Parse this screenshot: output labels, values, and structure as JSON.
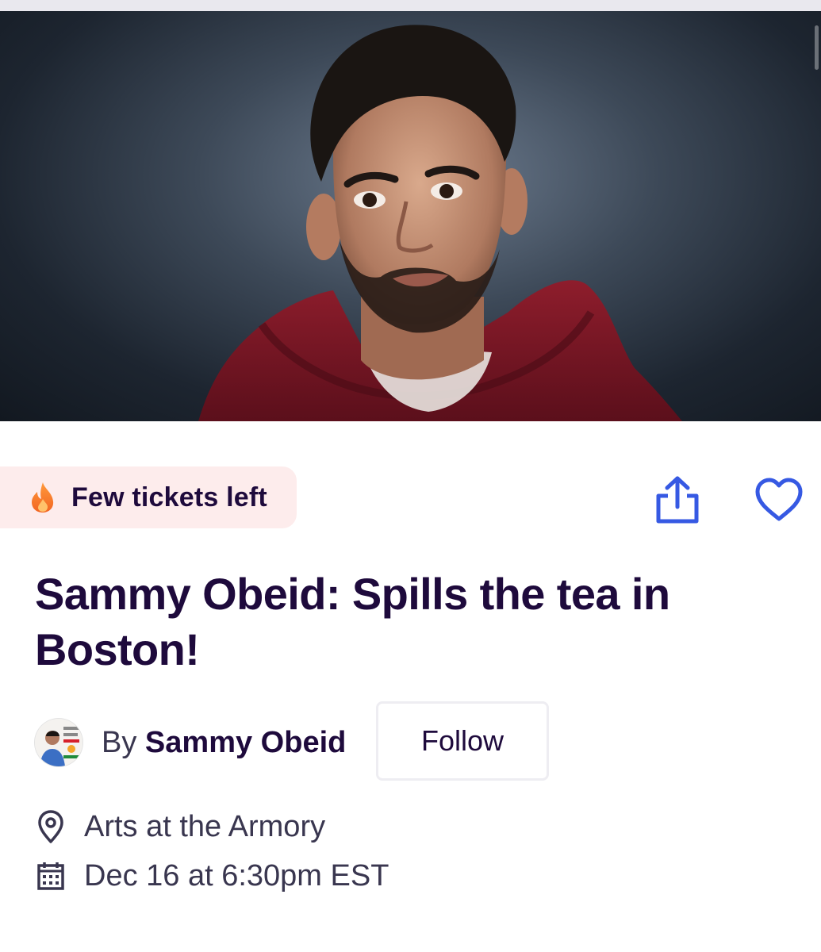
{
  "hero": {
    "image_description_icon": "portrait-photo"
  },
  "badge": {
    "label": "Few tickets left",
    "icon": "fire-icon",
    "color": "#fdecec"
  },
  "actions": {
    "share_icon": "share-icon",
    "like_icon": "heart-icon",
    "accent": "#3659e3"
  },
  "event": {
    "title": "Sammy Obeid: Spills the tea in Boston!"
  },
  "organizer": {
    "by": "By",
    "name": "Sammy Obeid",
    "follow_label": "Follow",
    "avatar_icon": "organizer-avatar"
  },
  "details": {
    "location": "Arts at the Armory",
    "location_icon": "map-pin-icon",
    "datetime": "Dec 16 at 6:30pm EST",
    "datetime_icon": "calendar-icon"
  },
  "colors": {
    "text_primary": "#1e0a3c",
    "text_secondary": "#39364f"
  }
}
